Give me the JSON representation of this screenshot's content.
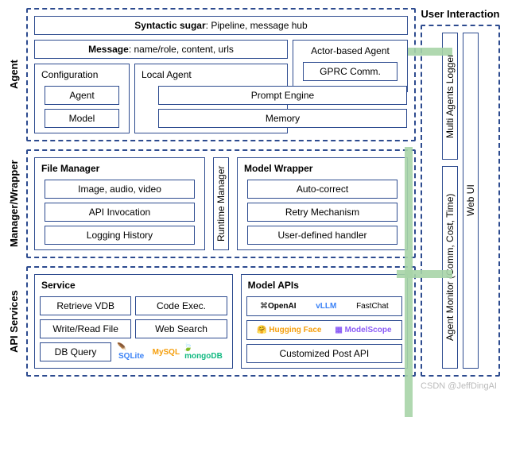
{
  "sections": {
    "agent": {
      "label": "Agent",
      "syntactic_sugar": {
        "title": "Syntactic sugar",
        "desc": "Pipeline, message hub"
      },
      "message": {
        "title": "Message",
        "desc": "name/role, content, urls"
      },
      "configuration": {
        "title": "Configuration",
        "items": [
          "Agent",
          "Model"
        ]
      },
      "local_agent": {
        "title": "Local Agent"
      },
      "actor_agent": {
        "title": "Actor-based Agent",
        "gprc": "GPRC Comm."
      },
      "shared": {
        "prompt": "Prompt Engine",
        "memory": "Memory"
      }
    },
    "manager": {
      "label": "Manager/Wrapper",
      "file_manager": {
        "title": "File Manager",
        "items": [
          "Image, audio, video",
          "API Invocation",
          "Logging History"
        ]
      },
      "runtime": "Runtime Manager",
      "model_wrapper": {
        "title": "Model Wrapper",
        "items": [
          "Auto-correct",
          "Retry Mechanism",
          "User-defined handler"
        ]
      }
    },
    "api": {
      "label": "API Services",
      "service": {
        "title": "Service",
        "items": [
          "Retrieve VDB",
          "Code Exec.",
          "Write/Read File",
          "Web Search",
          "DB Query"
        ]
      },
      "model_apis": {
        "title": "Model APIs",
        "providers": [
          "OpenAI",
          "vLLM",
          "FastChat",
          "Hugging Face",
          "ModelScope"
        ],
        "custom": "Customized Post API"
      }
    },
    "user_interaction": {
      "label": "User Interaction",
      "items": [
        "Multi Agents Logger",
        "Agent Monitor (Comm, Cost, Time)",
        "Web UI"
      ]
    }
  },
  "watermark": "CSDN @JeffDingAI",
  "db_logos": [
    "SQLite",
    "MySQL",
    "mongoDB"
  ]
}
